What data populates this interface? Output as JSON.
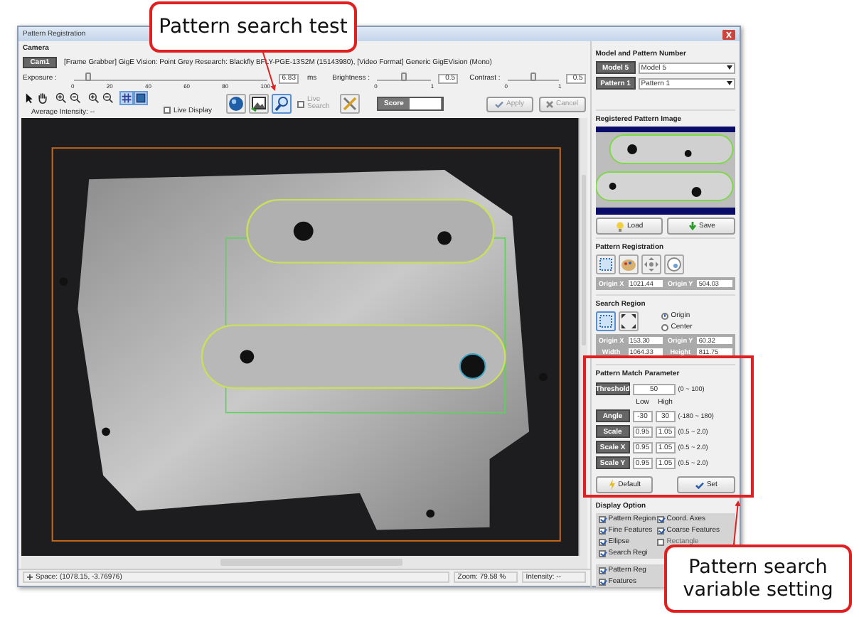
{
  "window": {
    "title": "Pattern Registration"
  },
  "camera": {
    "title": "Camera",
    "cam_button": "Cam1",
    "info": "[Frame Grabber] GigE Vision: Point Grey Research: Blackfly BFLY-PGE-13S2M (15143980),   [Video Format] Generic GigEVision (Mono)",
    "sliders": [
      {
        "label": "Exposure :",
        "ticks": [
          "0",
          "20",
          "40",
          "60",
          "80",
          "100"
        ],
        "level": 0.07,
        "value": "6.83",
        "unit": "ms"
      },
      {
        "label": "Brightness :",
        "ticks": [
          "0",
          "1"
        ],
        "level": 0.5,
        "value": "0.5"
      },
      {
        "label": "Contrast :",
        "ticks": [
          "0",
          "1"
        ],
        "level": 0.5,
        "value": "0.5"
      }
    ],
    "tools": [
      {
        "kind": "pointer",
        "selected": false
      },
      {
        "kind": "hand",
        "selected": false
      },
      {
        "kind": "zoom-in",
        "selected": false
      },
      {
        "kind": "zoom-out",
        "selected": false
      },
      {
        "kind": "zoom-in",
        "selected": false
      },
      {
        "kind": "zoom-out",
        "selected": false
      },
      {
        "kind": "grid",
        "selected": true
      },
      {
        "kind": "square",
        "selected": true
      }
    ],
    "average_intensity": "Average Intensity: --",
    "live_display": {
      "label": "Live Display",
      "checked": false
    },
    "live_search": {
      "label": "Live Search",
      "checked": false,
      "disabled": true
    },
    "score": {
      "label": "Score"
    },
    "apply": {
      "label": "Apply",
      "disabled": true
    },
    "cancel": {
      "label": "Cancel",
      "disabled": true
    }
  },
  "status_bar": {
    "space": "Space: (1078.15, -3.76976)",
    "zoom": "Zoom: 79.58 %",
    "intensity": "Intensity: --"
  },
  "side": {
    "model": {
      "title": "Model and Pattern Number",
      "rows": [
        {
          "button": "Model 5",
          "value": "Model 5"
        },
        {
          "button": "Pattern 1",
          "value": "Pattern 1"
        }
      ]
    },
    "registered_image": {
      "title": "Registered Pattern Image",
      "buttons": [
        "Load",
        "Save"
      ]
    },
    "pattern_registration": {
      "title": "Pattern Registration",
      "fields": [
        {
          "label": "Origin X",
          "value": "1021.44"
        },
        {
          "label": "Origin Y",
          "value": "504.03"
        }
      ]
    },
    "search_region": {
      "title": "Search Region",
      "radios": [
        {
          "label": "Origin",
          "selected": true
        },
        {
          "label": "Center",
          "selected": false
        }
      ],
      "fields": [
        {
          "label": "Origin X",
          "value": "153.30"
        },
        {
          "label": "Origin Y",
          "value": "60.32"
        },
        {
          "label": "Width",
          "value": "1064.33"
        },
        {
          "label": "Height",
          "value": "811.75"
        }
      ]
    },
    "match": {
      "title": "Pattern Match Parameter",
      "threshold": {
        "label": "Threshold",
        "value": "50",
        "range": "(0 ~ 100)"
      },
      "low": "Low",
      "high": "High",
      "rows": [
        {
          "label": "Angle",
          "low": "-30",
          "high": "30",
          "range": "(-180 ~ 180)"
        },
        {
          "label": "Scale",
          "low": "0.95",
          "high": "1.05",
          "range": "(0.5 ~ 2.0)"
        },
        {
          "label": "Scale X",
          "low": "0.95",
          "high": "1.05",
          "range": "(0.5 ~ 2.0)"
        },
        {
          "label": "Scale Y",
          "low": "0.95",
          "high": "1.05",
          "range": "(0.5 ~ 2.0)"
        }
      ],
      "buttons": [
        "Default",
        "Set"
      ]
    },
    "display": {
      "title": "Display Option",
      "options": [
        {
          "label": "Pattern Region",
          "checked": true,
          "disabled": false
        },
        {
          "label": "Coord. Axes",
          "checked": true,
          "disabled": false
        },
        {
          "label": "Fine Features",
          "checked": true,
          "disabled": false
        },
        {
          "label": "Coarse Features",
          "checked": true,
          "disabled": false
        },
        {
          "label": "Ellipse",
          "checked": true,
          "disabled": false
        },
        {
          "label": "Rectangle",
          "checked": false,
          "disabled": true
        },
        {
          "label": "Search Regi",
          "checked": true,
          "disabled": false
        }
      ],
      "options_2": [
        {
          "label": "Pattern Reg",
          "checked": true,
          "disabled": false
        },
        {
          "label": "Features",
          "checked": true,
          "disabled": false
        }
      ]
    }
  },
  "callouts": [
    {
      "text": "Pattern search test"
    },
    {
      "text": "Pattern search variable setting"
    }
  ]
}
